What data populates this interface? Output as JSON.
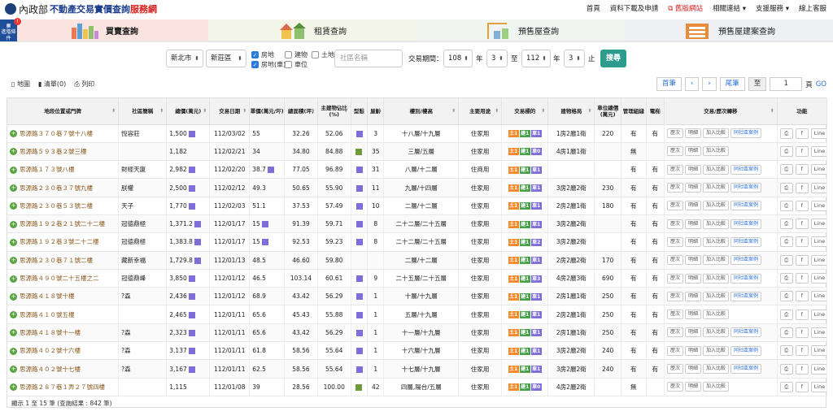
{
  "header": {
    "ministry": "內政部",
    "title": "不動產交易實價查詢",
    "title_red": "服務網",
    "nav": [
      "首頁",
      "資料下載及申請",
      "舊版網站",
      "相關連結 ▾",
      "支援服務 ▾",
      "線上客服"
    ]
  },
  "conditions_button": "進階條件",
  "conditions_badge": "!",
  "tabs": [
    "買賣查詢",
    "租賃查詢",
    "預售屋查詢",
    "預售屋建案查詢"
  ],
  "search": {
    "city": "新北市",
    "district": "新莊區",
    "checks": [
      {
        "label": "房地",
        "on": true
      },
      {
        "label": "建物",
        "on": false
      },
      {
        "label": "土地",
        "on": false
      },
      {
        "label": "房地(車)",
        "on": true
      },
      {
        "label": "車位",
        "on": false
      }
    ],
    "community_placeholder": "社區名稱",
    "period_label": "交易期間：",
    "from_year": "108",
    "from_month": "3",
    "to_label": "至",
    "to_year": "112",
    "to_month": "3",
    "year_label": "年",
    "end_label": "止",
    "submit": "搜尋"
  },
  "tools": [
    "地圖",
    "清單(0)",
    "列印"
  ],
  "pager": {
    "first": "首筆",
    "prev": "‹",
    "next": "›",
    "last": "尾筆",
    "to": "至",
    "page": "1",
    "unit": "頁",
    "go": "GO"
  },
  "columns": [
    "地段位置或門牌",
    "社區簡稱",
    "總價(萬元)",
    "交易日期",
    "單價(萬元/坪)",
    "總面積(坪)",
    "主建物佔比(%)",
    "型態",
    "屋齡",
    "樓別/樓高",
    "主要用途",
    "交易標的",
    "建物格局",
    "車位總價(萬元)",
    "管理組織",
    "電梯",
    "交易/歷次轉移",
    "功能"
  ],
  "row_buttons": {
    "history": "歷次",
    "detail": "明細",
    "compare": "加入比較",
    "same": "同社區案例",
    "share": "Line"
  },
  "rows": [
    {
      "addr": "思源路３７０巷７號十八樓",
      "comm": "悅容莊",
      "price": "1,500",
      "pm": true,
      "date": "112/03/02",
      "unit": "55",
      "um": false,
      "area": "32.26",
      "ratio": "52.06",
      "type": "p",
      "age": "3",
      "floor": "十八層/十九層",
      "use": "住家用",
      "tag": "o1g1p1",
      "layout": "1房2廳1衛",
      "park": "220",
      "mgmt": "有",
      "elev": "有",
      "same": true
    },
    {
      "addr": "思源路５９３巷２號三樓",
      "comm": "",
      "price": "1,182",
      "pm": false,
      "date": "112/02/21",
      "unit": "34",
      "um": false,
      "area": "34.80",
      "ratio": "84.88",
      "type": "g",
      "age": "35",
      "floor": "三層/五層",
      "use": "住家用",
      "tag": "o1g1p0",
      "layout": "4房1廳1衛",
      "park": "",
      "mgmt": "無",
      "elev": "",
      "same": false
    },
    {
      "addr": "思源路１７３號八樓",
      "comm": "財經天廈",
      "price": "2,982",
      "pm": true,
      "date": "112/02/20",
      "unit": "38.7",
      "um": true,
      "area": "77.05",
      "ratio": "96.89",
      "type": "p",
      "age": "31",
      "floor": "八層/十二層",
      "use": "住商用",
      "tag": "o1g1p1",
      "layout": "",
      "park": "",
      "mgmt": "有",
      "elev": "有",
      "same": true
    },
    {
      "addr": "思源路２３０巷３７號九樓",
      "comm": "朕權",
      "price": "2,500",
      "pm": true,
      "date": "112/02/12",
      "unit": "49.3",
      "um": false,
      "area": "50.65",
      "ratio": "55.90",
      "type": "p",
      "age": "11",
      "floor": "九層/十四層",
      "use": "住家用",
      "tag": "o1g1p1",
      "layout": "3房2廳2衛",
      "park": "230",
      "mgmt": "有",
      "elev": "有",
      "same": true
    },
    {
      "addr": "思源路２３０巷５３號二樓",
      "comm": "天子",
      "price": "1,770",
      "pm": true,
      "date": "112/02/03",
      "unit": "51.1",
      "um": false,
      "area": "37.53",
      "ratio": "57.49",
      "type": "p",
      "age": "10",
      "floor": "二層/十二層",
      "use": "住家用",
      "tag": "o1g1p1",
      "layout": "2房2廳1衛",
      "park": "180",
      "mgmt": "有",
      "elev": "有",
      "same": true
    },
    {
      "addr": "思源路１９２巷２１號二十二樓",
      "comm": "冠德鼎極",
      "price": "1,371.2",
      "pm": true,
      "date": "112/01/17",
      "unit": "15",
      "um": true,
      "area": "91.39",
      "ratio": "59.71",
      "type": "p",
      "age": "8",
      "floor": "二十二層/二十五層",
      "use": "住家用",
      "tag": "o1g1p1",
      "layout": "3房2廳2衛",
      "park": "",
      "mgmt": "有",
      "elev": "有",
      "same": true
    },
    {
      "addr": "思源路１９２巷３號二十二樓",
      "comm": "冠德鼎極",
      "price": "1,383.8",
      "pm": true,
      "date": "112/01/17",
      "unit": "15",
      "um": true,
      "area": "92.53",
      "ratio": "59.23",
      "type": "p",
      "age": "8",
      "floor": "二十二層/二十五層",
      "use": "住家用",
      "tag": "o1g1p2",
      "layout": "3房2廳2衛",
      "park": "",
      "mgmt": "有",
      "elev": "有",
      "same": true
    },
    {
      "addr": "思源路２３０巷７１號二樓",
      "comm": "藏新幸福",
      "price": "1,729.8",
      "pm": true,
      "date": "112/01/13",
      "unit": "48.5",
      "um": false,
      "area": "46.60",
      "ratio": "59.80",
      "type": "",
      "age": "",
      "floor": "二層/十二層",
      "use": "住家用",
      "tag": "o1g1p1",
      "layout": "2房2廳2衛",
      "park": "170",
      "mgmt": "有",
      "elev": "有",
      "same": true
    },
    {
      "addr": "思源路４９０號二十五樓之二",
      "comm": "冠德鼎峰",
      "price": "3,850",
      "pm": true,
      "date": "112/01/12",
      "unit": "46.5",
      "um": false,
      "area": "103.14",
      "ratio": "60.61",
      "type": "p",
      "age": "9",
      "floor": "二十五層/二十五層",
      "use": "住家用",
      "tag": "o1g1p3",
      "layout": "4房2廳3衛",
      "park": "690",
      "mgmt": "有",
      "elev": "有",
      "same": true
    },
    {
      "addr": "思源路４１８號十樓",
      "comm": "?森",
      "price": "2,436",
      "pm": true,
      "date": "112/01/12",
      "unit": "68.9",
      "um": false,
      "area": "43.42",
      "ratio": "56.29",
      "type": "p",
      "age": "1",
      "floor": "十層/十九層",
      "use": "住家用",
      "tag": "o1g1p1",
      "layout": "2房1廳1衛",
      "park": "250",
      "mgmt": "有",
      "elev": "有",
      "same": true
    },
    {
      "addr": "思源路４１０號五樓",
      "comm": "",
      "price": "2,465",
      "pm": true,
      "date": "112/01/11",
      "unit": "65.6",
      "um": false,
      "area": "45.43",
      "ratio": "55.88",
      "type": "p",
      "age": "1",
      "floor": "五層/十九層",
      "use": "住家用",
      "tag": "o1g1p1",
      "layout": "2房2廳1衛",
      "park": "250",
      "mgmt": "有",
      "elev": "有",
      "same": false
    },
    {
      "addr": "思源路４１８號十一樓",
      "comm": "?森",
      "price": "2,323",
      "pm": true,
      "date": "112/01/11",
      "unit": "65.6",
      "um": false,
      "area": "43.42",
      "ratio": "56.29",
      "type": "p",
      "age": "1",
      "floor": "十一層/十九層",
      "use": "住家用",
      "tag": "o1g1p1",
      "layout": "2房1廳1衛",
      "park": "250",
      "mgmt": "有",
      "elev": "有",
      "same": true
    },
    {
      "addr": "思源路４０２號十六樓",
      "comm": "?森",
      "price": "3,137",
      "pm": true,
      "date": "112/01/11",
      "unit": "61.8",
      "um": false,
      "area": "58.56",
      "ratio": "55.64",
      "type": "p",
      "age": "1",
      "floor": "十六層/十九層",
      "use": "住家用",
      "tag": "o1g1p1",
      "layout": "3房2廳2衛",
      "park": "240",
      "mgmt": "有",
      "elev": "有",
      "same": true
    },
    {
      "addr": "思源路４０２號十七樓",
      "comm": "?森",
      "price": "3,167",
      "pm": true,
      "date": "112/01/11",
      "unit": "62.5",
      "um": false,
      "area": "58.56",
      "ratio": "55.64",
      "type": "p",
      "age": "1",
      "floor": "十七層/十九層",
      "use": "住家用",
      "tag": "o1g1p1",
      "layout": "3房2廳2衛",
      "park": "240",
      "mgmt": "有",
      "elev": "有",
      "same": true
    },
    {
      "addr": "思源路２８７巷１弄２７號四樓",
      "comm": "",
      "price": "1,115",
      "pm": false,
      "date": "112/01/08",
      "unit": "39",
      "um": false,
      "area": "28.56",
      "ratio": "100.00",
      "type": "g",
      "age": "42",
      "floor": "四層,陽台/五層",
      "use": "住家用",
      "tag": "o1g1p0",
      "layout": "4房2廳2衛",
      "park": "",
      "mgmt": "無",
      "elev": "",
      "same": false
    }
  ],
  "footer": "顯示 1 至 15 筆 (查詢結果 : 842 筆)"
}
